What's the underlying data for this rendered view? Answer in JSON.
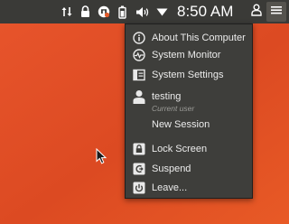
{
  "top_panel": {
    "clock": "8:50 AM",
    "icons": [
      "network-transfer-icon",
      "lock-icon",
      "keyboard-input-icon",
      "battery-icon",
      "volume-icon",
      "dropdown-arrow-icon",
      "user-icon",
      "menu-icon"
    ]
  },
  "session_menu": {
    "about_label": "About This Computer",
    "monitor_label": "System Monitor",
    "settings_label": "System Settings",
    "user": {
      "name": "testing",
      "status": "Current user"
    },
    "new_session_label": "New Session",
    "lock_label": "Lock Screen",
    "suspend_label": "Suspend",
    "leave_label": "Leave..."
  },
  "colors": {
    "panel": "#3a3a37",
    "menu": "#3e3e3b",
    "desktop": "#e0502a",
    "text": "#ececec"
  }
}
